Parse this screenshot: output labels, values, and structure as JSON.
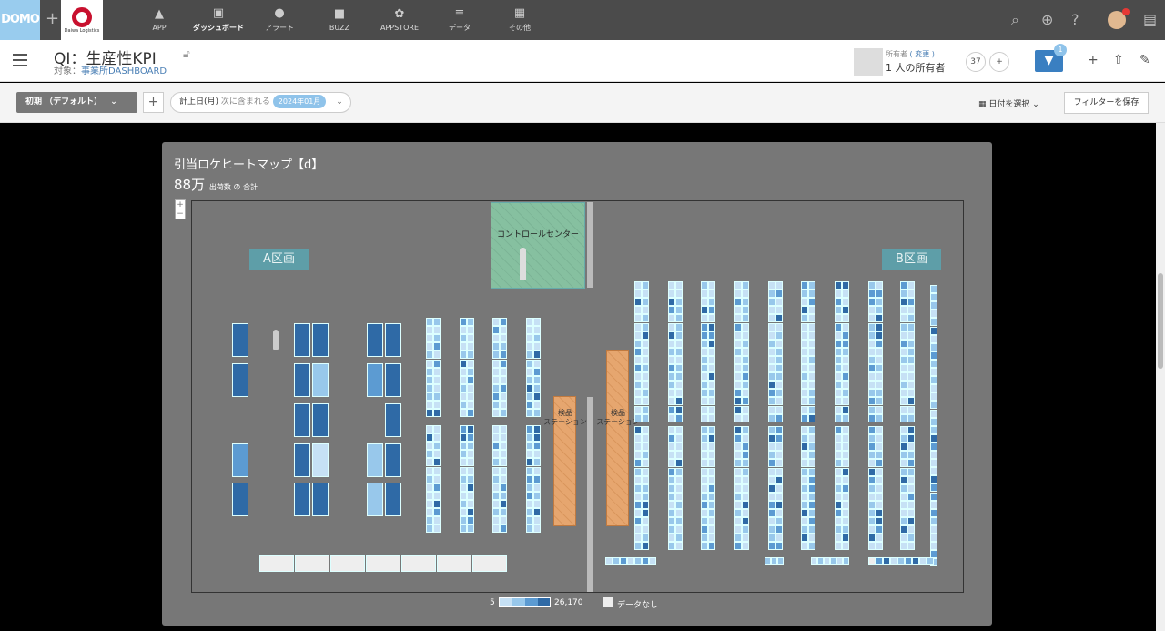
{
  "topbar": {
    "logo": "DOMO",
    "brand_text": "Daiwa Logistics",
    "nav": [
      {
        "label": "APP",
        "icon": "rocket-icon"
      },
      {
        "label": "ダッシュボード",
        "icon": "dashboard-icon"
      },
      {
        "label": "アラート",
        "icon": "bell-icon"
      },
      {
        "label": "BUZZ",
        "icon": "chat-icon"
      },
      {
        "label": "APPSTORE",
        "icon": "store-icon"
      },
      {
        "label": "データ",
        "icon": "database-icon"
      },
      {
        "label": "その他",
        "icon": "grid-icon"
      }
    ]
  },
  "header": {
    "title": "QI：生産性KPI",
    "subject_prefix": "対象：",
    "subject_link": "事業所DASHBOARD",
    "owner_label": "所有者",
    "owner_change": "( 変更 )",
    "owner_count": "1 人の所有者",
    "share_count": "37",
    "filter_badge": "1"
  },
  "filterbar": {
    "initial": "初期 （デフォルト）",
    "filter_field": "計上日(月)",
    "filter_op": "次に含まれる",
    "filter_value": "2024年01月",
    "date_select": "日付を選択",
    "save_filter": "フィルターを保存"
  },
  "card": {
    "title": "引当ロケヒートマップ【d】",
    "value": "88万",
    "value_caption": "出荷数 の 合計",
    "control_center": "コントロールセンター",
    "zone_a": "A区画",
    "zone_b": "B区画",
    "station_label_1": "検品",
    "station_label_2": "ステーション",
    "legend_min": "5",
    "legend_max": "26,170",
    "legend_nodata": "データなし"
  },
  "colors": {
    "c1": "#c6e1f5",
    "c2": "#98c8eb",
    "c3": "#5c9bd2",
    "c4": "#2f6aa6",
    "nodata": "#eeeeee"
  }
}
